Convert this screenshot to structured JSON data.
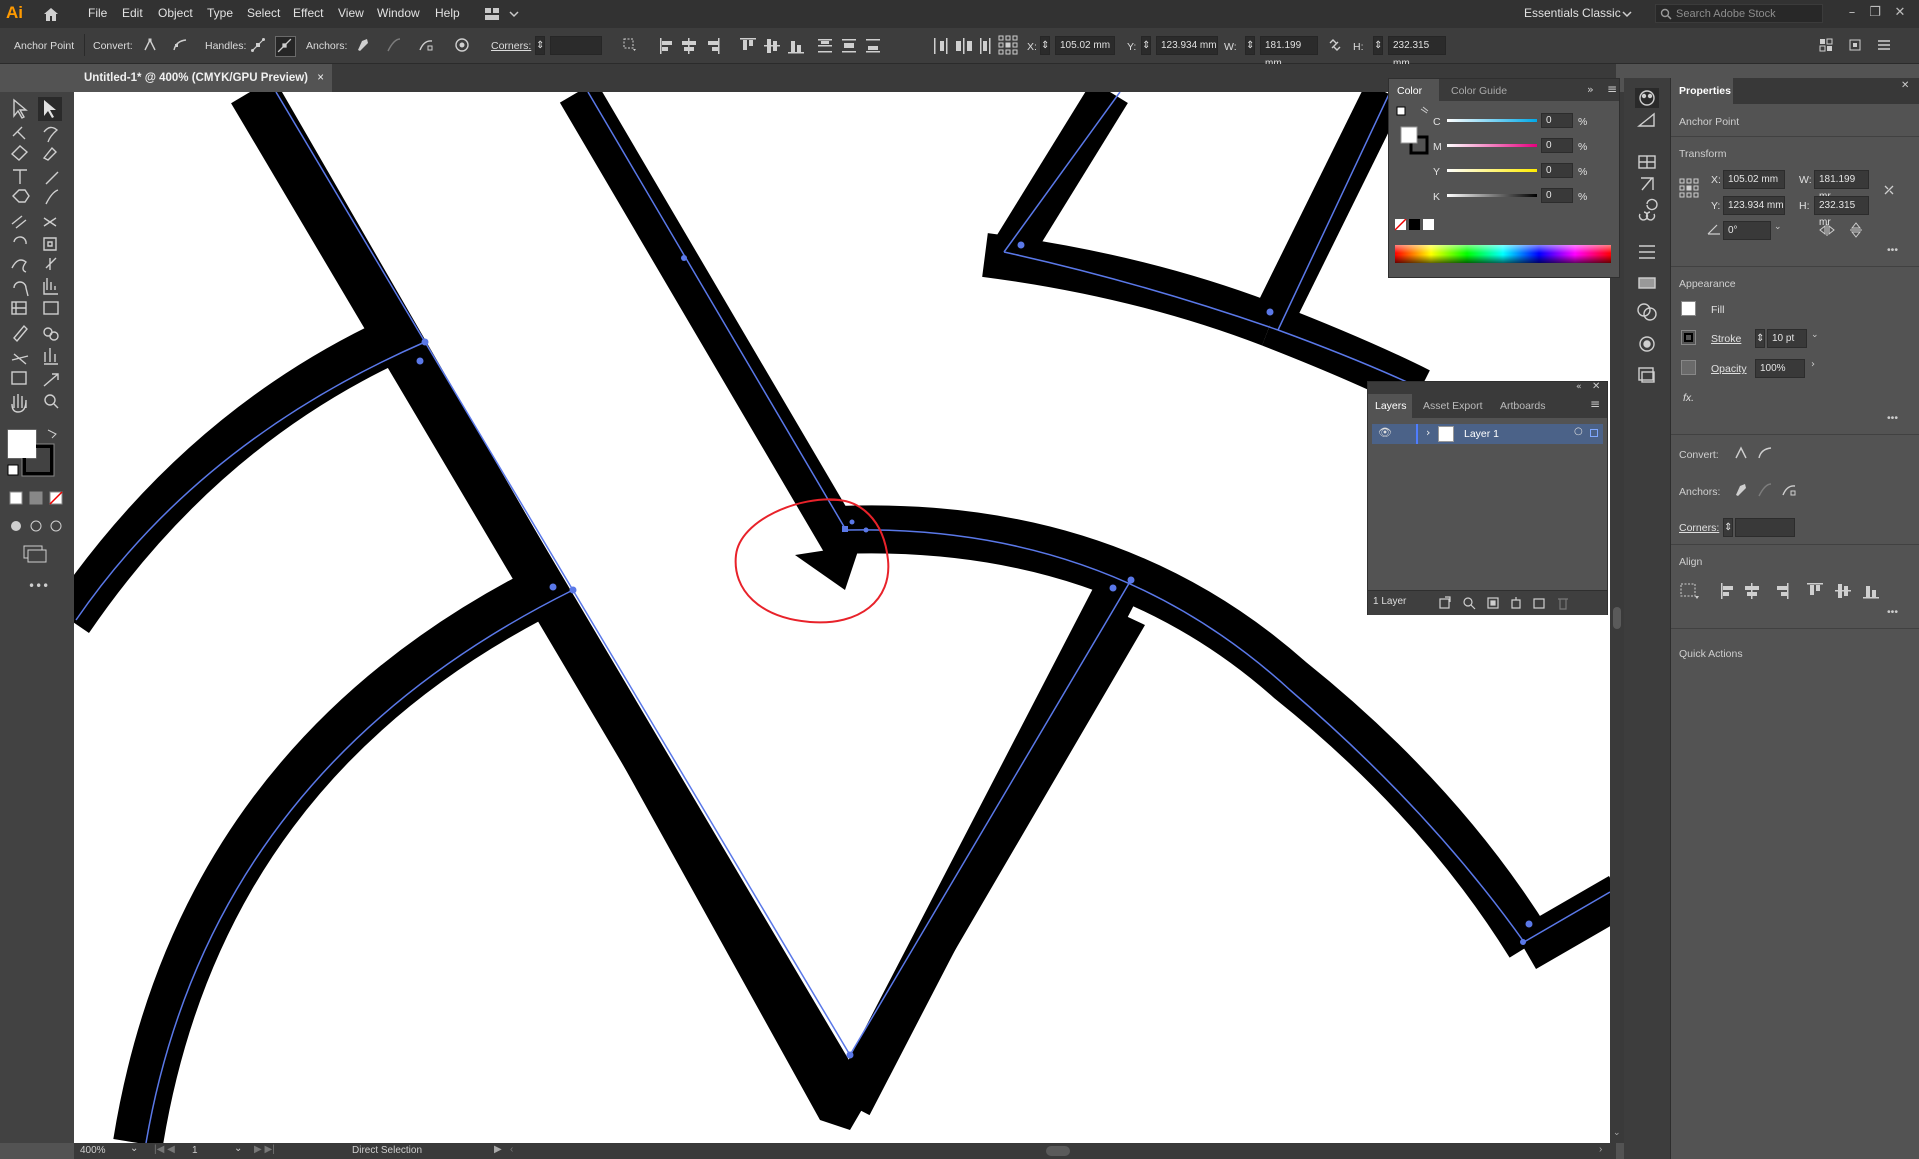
{
  "app": {
    "logo": "Ai",
    "menu": [
      "File",
      "Edit",
      "Object",
      "Type",
      "Select",
      "Effect",
      "View",
      "Window",
      "Help"
    ],
    "workspace": "Essentials Classic",
    "search_placeholder": "Search Adobe Stock"
  },
  "controlbar": {
    "context": "Anchor Point",
    "convert": "Convert:",
    "handles": "Handles:",
    "anchors": "Anchors:",
    "corners": "Corners:",
    "x_label": "X:",
    "x": "105.02 mm",
    "y_label": "Y:",
    "y": "123.934 mm",
    "w_label": "W:",
    "w": "181.199 mm",
    "h_label": "H:",
    "h": "232.315 mm"
  },
  "document": {
    "tab_title": "Untitled-1* @ 400% (CMYK/GPU Preview)",
    "close": "×"
  },
  "status": {
    "zoom": "400%",
    "artboard": "1",
    "tool": "Direct Selection"
  },
  "color_panel": {
    "tabs": [
      "Color",
      "Color Guide"
    ],
    "channels": [
      {
        "label": "C",
        "value": "0",
        "unit": "%",
        "color": "#00a9e8"
      },
      {
        "label": "M",
        "value": "0",
        "unit": "%",
        "color": "#e5007e"
      },
      {
        "label": "Y",
        "value": "0",
        "unit": "%",
        "color": "#ffec00"
      },
      {
        "label": "K",
        "value": "0",
        "unit": "%",
        "color": "#000000"
      }
    ]
  },
  "layers_panel": {
    "tabs": [
      "Layers",
      "Asset Export",
      "Artboards"
    ],
    "layer_name": "Layer 1",
    "count": "1 Layer"
  },
  "properties": {
    "tab": "Properties",
    "selection": "Anchor Point",
    "transform_title": "Transform",
    "x_label": "X:",
    "x": "105.02 mm",
    "w_label": "W:",
    "w": "181.199 mr",
    "y_label": "Y:",
    "y": "123.934 mm",
    "h_label": "H:",
    "h": "232.315 mr",
    "angle": "0°",
    "appearance_title": "Appearance",
    "fill": "Fill",
    "stroke": "Stroke",
    "stroke_weight": "10 pt",
    "opacity": "Opacity",
    "opacity_value": "100%",
    "fx": "fx.",
    "convert": "Convert:",
    "anchors": "Anchors:",
    "corners": "Corners:",
    "align_title": "Align",
    "quick_actions": "Quick Actions",
    "more": "•••"
  },
  "colors": {
    "accent_path": "#5a78e8",
    "annotation": "#e8222a",
    "logo": "#ff9a00"
  }
}
